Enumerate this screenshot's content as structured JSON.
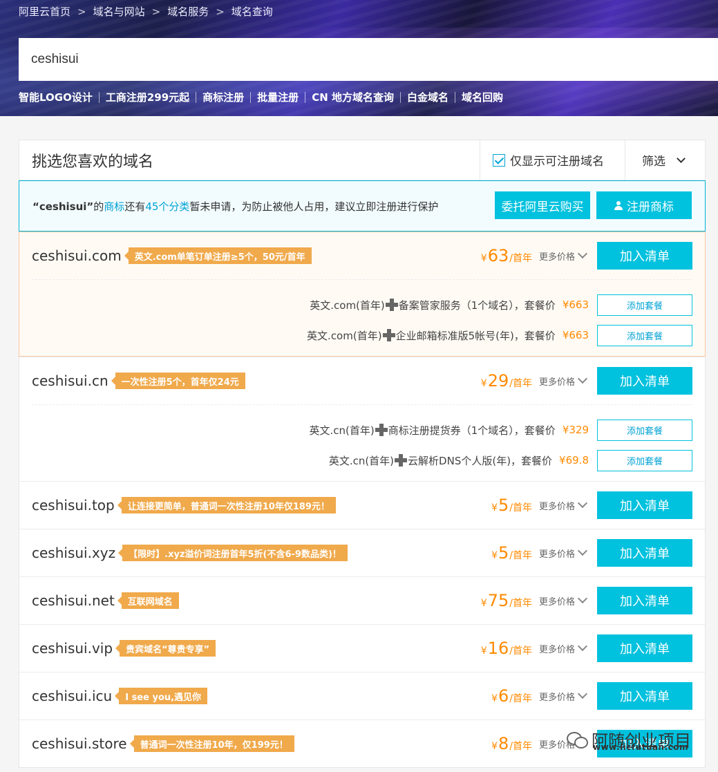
{
  "breadcrumb": [
    "阿里云首页",
    "域名与网站",
    "域名服务",
    "域名查询"
  ],
  "breadcrumb_sep": ">",
  "search": {
    "value": "ceshisui"
  },
  "quick_links": [
    "智能LOGO设计",
    "工商注册299元起",
    "商标注册",
    "批量注册",
    "CN 地方域名查询",
    "白金域名",
    "域名回购"
  ],
  "panel": {
    "title": "挑选您喜欢的域名",
    "only_available_label": "仅显示可注册域名",
    "only_available_checked": true,
    "filter_label": "筛选"
  },
  "notice": {
    "quote_open": "“",
    "name": "ceshisui",
    "quote_close": "”",
    "t1": "的",
    "link_trademark": "商标",
    "t2": "还有",
    "link_categories": "45个分类",
    "t3": "暂未申请，为防止被他人占用，建议立即注册进行保护",
    "btn_entrust": "委托阿里云购买",
    "btn_register": "注册商标"
  },
  "price_unit": "/首年",
  "currency": "¥",
  "more_prices": "更多价格",
  "add_to_list": "加入清单",
  "add_package": "添加套餐",
  "domains": [
    {
      "name": "ceshisui.com",
      "tag": "英文.com单笔订单注册≥5个，50元/首年",
      "price": "63",
      "packages": [
        {
          "a": "英文.com(首年)",
          "b": "备案管家服务（1个域名），套餐价",
          "price": "¥663"
        },
        {
          "a": "英文.com(首年)",
          "b": "企业邮箱标准版5帐号(年)，套餐价",
          "price": "¥663"
        }
      ]
    },
    {
      "name": "ceshisui.cn",
      "tag": "一次性注册5个，首年仅24元",
      "price": "29",
      "packages": [
        {
          "a": "英文.cn(首年)",
          "b": "商标注册提货券（1个域名），套餐价",
          "price": "¥329"
        },
        {
          "a": "英文.cn(首年)",
          "b": "云解析DNS个人版(年)，套餐价",
          "price": "¥69.8"
        }
      ]
    },
    {
      "name": "ceshisui.top",
      "tag": "让连接更简单，普通词一次性注册10年仅189元！",
      "price": "5"
    },
    {
      "name": "ceshisui.xyz",
      "tag": "【限时】.xyz溢价词注册首年5折(不含6-9数品类)！",
      "price": "5"
    },
    {
      "name": "ceshisui.net",
      "tag": "互联网域名",
      "price": "75"
    },
    {
      "name": "ceshisui.vip",
      "tag": "贵宾域名“尊贵专享”",
      "price": "16"
    },
    {
      "name": "ceshisui.icu",
      "tag": "I see you,遇见你",
      "price": "6"
    },
    {
      "name": "ceshisui.store",
      "tag": "普通词一次性注册10年，仅199元！",
      "price": "8"
    }
  ],
  "watermark": {
    "text": "阿随创业项目",
    "url": "www.licfutuan.com"
  }
}
